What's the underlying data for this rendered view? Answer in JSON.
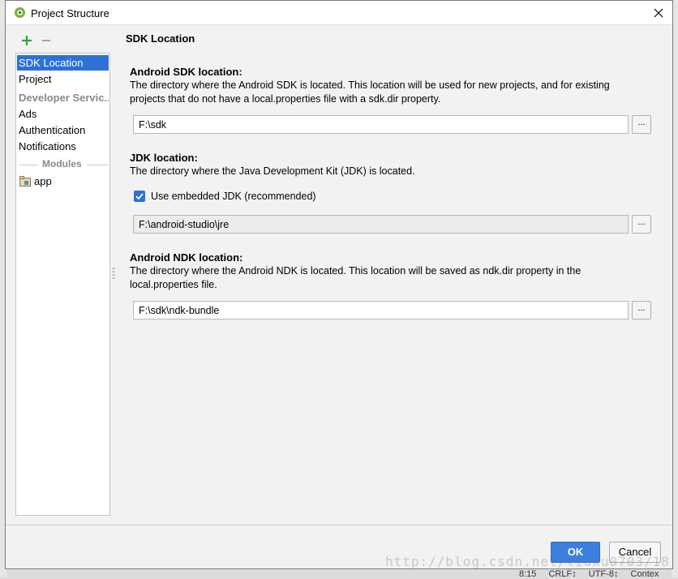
{
  "window": {
    "title": "Project Structure"
  },
  "toolbar": {
    "add_icon": "plus-icon",
    "remove_icon": "minus-icon"
  },
  "sidebar": {
    "items": [
      {
        "label": "SDK Location",
        "selected": true
      },
      {
        "label": "Project"
      },
      {
        "label": "Developer Servic...",
        "group": true
      },
      {
        "label": "Ads"
      },
      {
        "label": "Authentication"
      },
      {
        "label": "Notifications"
      }
    ],
    "modules_label": "Modules",
    "modules": [
      {
        "label": "app"
      }
    ]
  },
  "content": {
    "section_title": "SDK Location",
    "android_sdk": {
      "label": "Android SDK location:",
      "description": "The directory where the Android SDK is located. This location will be used for new projects, and for existing projects that do not have a local.properties file with a sdk.dir property.",
      "value": "F:\\sdk",
      "browse_label": "..."
    },
    "jdk": {
      "label": "JDK location:",
      "description": "The directory where the Java Development Kit (JDK) is located.",
      "checkbox_label": "Use embedded JDK (recommended)",
      "checkbox_checked": true,
      "value": "F:\\android-studio\\jre",
      "browse_label": "..."
    },
    "android_ndk": {
      "label": "Android NDK location:",
      "description": "The directory where the Android NDK is located. This location will be saved as ndk.dir property in the local.properties file.",
      "value": "F:\\sdk\\ndk-bundle",
      "browse_label": "..."
    }
  },
  "buttons": {
    "ok": "OK",
    "cancel": "Cancel"
  },
  "status_bar": {
    "position": "8:15",
    "line_sep": "CRLF↕",
    "encoding": "UTF-8↕",
    "context": "Contex"
  },
  "watermark": "http://blog.csdn.net/liuxu0703/18",
  "colors": {
    "accent": "#2e71d4",
    "ok_button": "#3b7fe0"
  }
}
